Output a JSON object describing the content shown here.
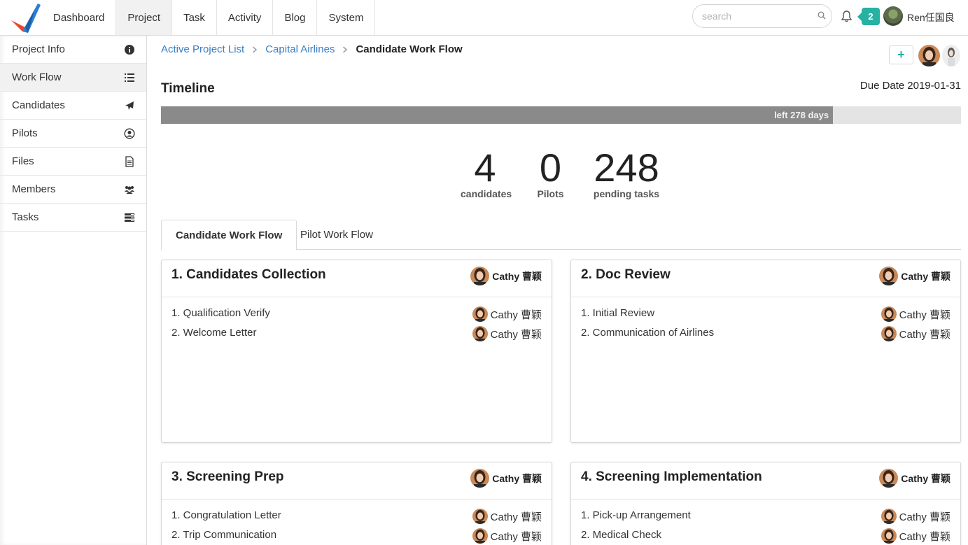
{
  "nav": {
    "items": [
      "Dashboard",
      "Project",
      "Task",
      "Activity",
      "Blog",
      "System"
    ],
    "active": "Project"
  },
  "header": {
    "search_placeholder": "search",
    "notification_count": "2",
    "user_name": "Ren任国良"
  },
  "sidebar": {
    "items": [
      {
        "label": "Project Info",
        "icon": "info-icon"
      },
      {
        "label": "Work Flow",
        "icon": "list-icon"
      },
      {
        "label": "Candidates",
        "icon": "airplane-icon"
      },
      {
        "label": "Pilots",
        "icon": "user-circle-icon"
      },
      {
        "label": "Files",
        "icon": "file-icon"
      },
      {
        "label": "Members",
        "icon": "users-icon"
      },
      {
        "label": "Tasks",
        "icon": "tasks-icon"
      }
    ],
    "active": "Work Flow"
  },
  "breadcrumb": {
    "items": [
      "Active Project List",
      "Capital Airlines"
    ],
    "current": "Candidate Work Flow"
  },
  "add_button_label": "+",
  "timeline": {
    "title": "Timeline",
    "due_label": "Due Date",
    "due_date": "2019-01-31",
    "progress_text": "left 278 days",
    "progress_fraction": 0.84
  },
  "stats": [
    {
      "value": "4",
      "label": "candidates"
    },
    {
      "value": "0",
      "label": "Pilots"
    },
    {
      "value": "248",
      "label": "pending tasks"
    }
  ],
  "tabs": [
    "Candidate Work Flow",
    "Pilot Work Flow"
  ],
  "cards": [
    {
      "title": "1. Candidates Collection",
      "owner": "Cathy 曹颖",
      "tasks": [
        {
          "label": "1. Qualification Verify",
          "owner": "Cathy 曹颖"
        },
        {
          "label": "2. Welcome Letter",
          "owner": "Cathy 曹颖"
        }
      ]
    },
    {
      "title": "2. Doc Review",
      "owner": "Cathy 曹颖",
      "tasks": [
        {
          "label": "1. Initial Review",
          "owner": "Cathy 曹颖"
        },
        {
          "label": "2. Communication of Airlines",
          "owner": "Cathy 曹颖"
        }
      ]
    },
    {
      "title": "3. Screening Prep",
      "owner": "Cathy 曹颖",
      "tasks": [
        {
          "label": "1. Congratulation Letter",
          "owner": "Cathy 曹颖"
        },
        {
          "label": "2. Trip Communication",
          "owner": "Cathy 曹颖"
        }
      ]
    },
    {
      "title": "4. Screening Implementation",
      "owner": "Cathy 曹颖",
      "tasks": [
        {
          "label": "1. Pick-up Arrangement",
          "owner": "Cathy 曹颖"
        },
        {
          "label": "2. Medical Check",
          "owner": "Cathy 曹颖"
        }
      ]
    }
  ],
  "colors": {
    "accent": "#26b1a3",
    "link": "#3b7dc4",
    "progress_fill": "#8a8a8a",
    "progress_track": "#e4e4e4"
  }
}
